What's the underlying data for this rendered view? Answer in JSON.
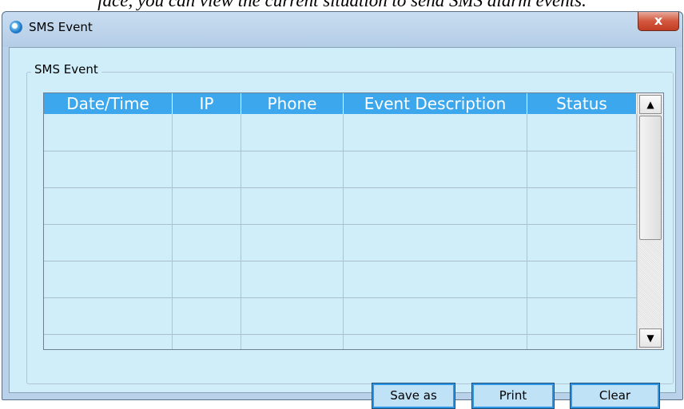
{
  "caption": "face, you can view the current situation to send SMS alarm events.",
  "window": {
    "title": "SMS Event",
    "close_label": "x"
  },
  "group": {
    "label": "SMS Event"
  },
  "table": {
    "columns": [
      "Date/Time",
      "IP",
      "Phone",
      "Event Description",
      "Status"
    ],
    "rows": []
  },
  "buttons": {
    "save_as": "Save as",
    "print": "Print",
    "clear": "Clear"
  },
  "scrollbar": {
    "up": "▲",
    "down": "▼"
  }
}
